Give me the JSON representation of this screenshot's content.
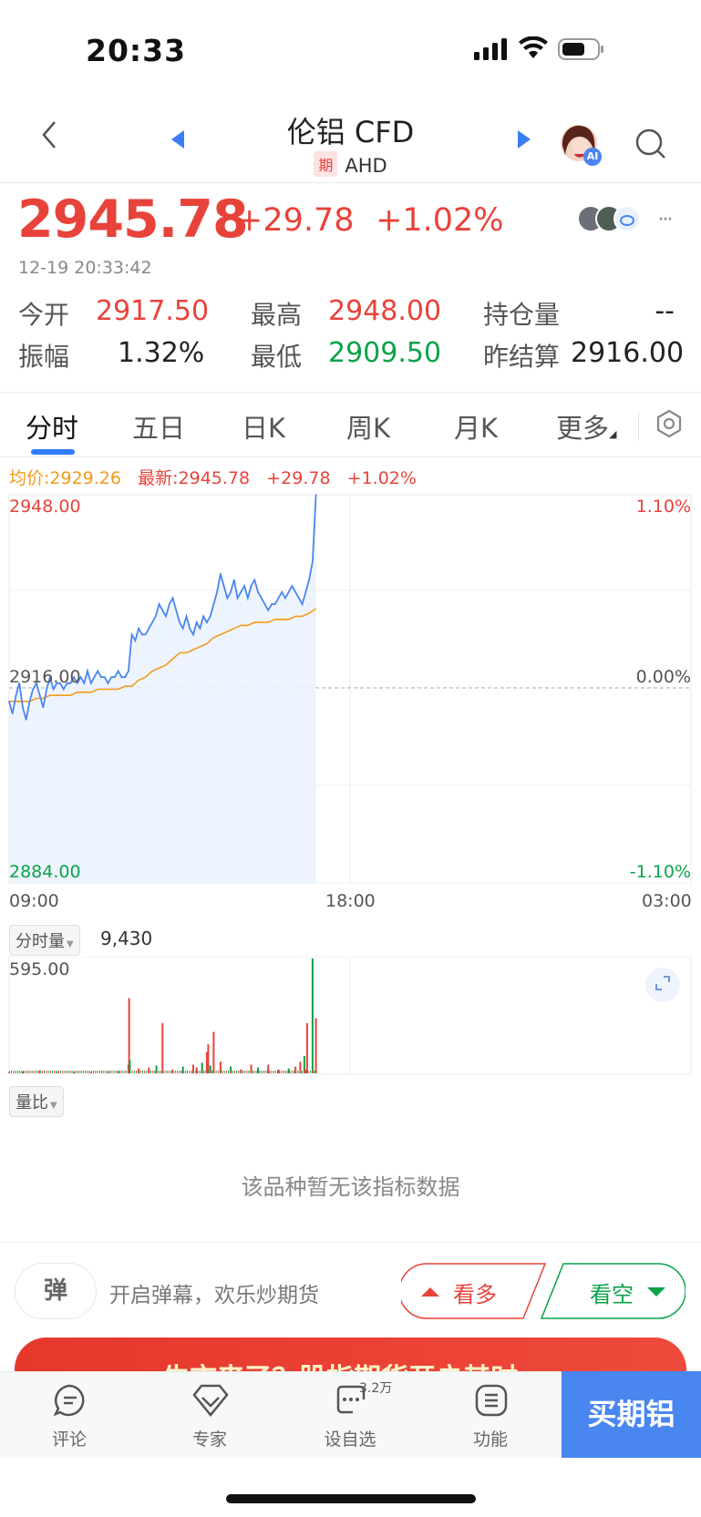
{
  "status": {
    "time": "20:33"
  },
  "nav": {
    "title": "伦铝 CFD",
    "badge": "期",
    "code": "AHD",
    "avatar_badge": "AI"
  },
  "quote": {
    "price": "2945.78",
    "change": "+29.78",
    "change_pct": "+1.02%",
    "time": "12-19 20:33:42",
    "more": "···"
  },
  "stats": {
    "open_label": "今开",
    "open": "2917.50",
    "high_label": "最高",
    "high": "2948.00",
    "oi_label": "持仓量",
    "oi": "--",
    "amp_label": "振幅",
    "amp": "1.32%",
    "low_label": "最低",
    "low": "2909.50",
    "settle_label": "昨结算",
    "settle": "2916.00"
  },
  "tabs": [
    "分时",
    "五日",
    "日K",
    "周K",
    "月K",
    "更多"
  ],
  "info": {
    "avg": "均价:2929.26",
    "latest": "最新:2945.78",
    "chg": "+29.78",
    "pct": "+1.02%"
  },
  "price_chart": {
    "y_top": "2948.00",
    "y_mid": "2916.00",
    "y_bottom": "2884.00",
    "pct_top": "1.10%",
    "pct_mid": "0.00%",
    "pct_bottom": "-1.10%",
    "x_labels": [
      "09:00",
      "18:00",
      "03:00"
    ]
  },
  "volume": {
    "selector": "分时量",
    "value": "9,430",
    "max_label": "595.00"
  },
  "ratio": {
    "selector": "量比",
    "empty": "该品种暂无该指标数据"
  },
  "actions": {
    "danmu_icon": "弹",
    "danmu_text": "开启弹幕，欢乐炒期货",
    "bull": "看多",
    "bear": "看空"
  },
  "banner": {
    "text": "牛市来了？股指期货开户其时 ›"
  },
  "tabbar": {
    "comment": "评论",
    "expert": "专家",
    "watch": "设自选",
    "watch_count": "3.2万",
    "function": "功能",
    "buy": "买期铝"
  },
  "colors": {
    "up": "#e8433b",
    "down": "#0aa34a",
    "accent": "#2f7cf6",
    "avg_line": "#f39a1b",
    "price_line": "#4a86f0"
  },
  "chart_data": {
    "type": "line",
    "title": "",
    "ylim": [
      2884,
      2948
    ],
    "reference": 2916,
    "series": [
      {
        "name": "",
        "x": [
          0,
          5,
          10,
          15,
          20,
          25,
          30,
          35,
          40,
          45,
          50,
          55,
          60,
          65,
          70,
          75,
          80,
          85,
          90,
          95,
          100,
          105,
          110,
          115,
          120,
          125,
          130,
          135,
          140,
          145,
          150,
          155,
          160,
          165,
          170,
          175,
          180,
          185,
          190,
          195,
          200,
          205,
          210,
          215,
          220,
          225,
          230,
          235,
          240,
          245,
          250,
          255,
          260,
          265,
          270,
          275,
          280,
          285,
          290,
          295,
          300,
          305,
          310,
          315,
          320,
          325,
          330,
          335,
          340,
          345,
          350,
          355,
          360,
          365,
          370,
          375,
          380,
          385,
          390,
          395,
          400,
          405,
          410,
          415,
          420,
          425,
          430,
          435,
          440,
          445,
          450
        ],
        "values": [
          2914,
          2912,
          2915,
          2917,
          2913,
          2911,
          2914,
          2916,
          2917,
          2915,
          2913,
          2916,
          2918,
          2916,
          2917,
          2917,
          2916,
          2917,
          2917,
          2918,
          2917,
          2918,
          2917,
          2919,
          2917,
          2918,
          2919,
          2918,
          2918,
          2917,
          2918,
          2918,
          2919,
          2918,
          2918,
          2919,
          2925,
          2924,
          2926,
          2925,
          2925,
          2926,
          2927,
          2928,
          2930,
          2929,
          2928,
          2930,
          2931,
          2929,
          2927,
          2926,
          2928,
          2926,
          2925,
          2927,
          2926,
          2928,
          2927,
          2928,
          2930,
          2932,
          2935,
          2933,
          2931,
          2932,
          2934,
          2931,
          2932,
          2933,
          2931,
          2933,
          2934,
          2932,
          2931,
          2930,
          2929,
          2930,
          2930,
          2931,
          2932,
          2931,
          2932,
          2933,
          2932,
          2931,
          2930,
          2932,
          2934,
          2937,
          2948
        ]
      },
      {
        "name": "",
        "x": [
          0,
          10,
          20,
          30,
          40,
          50,
          60,
          70,
          80,
          90,
          100,
          110,
          120,
          130,
          140,
          150,
          160,
          170,
          180,
          190,
          200,
          210,
          220,
          230,
          240,
          250,
          260,
          270,
          280,
          290,
          300,
          310,
          320,
          330,
          340,
          350,
          360,
          370,
          380,
          390,
          400,
          410,
          420,
          430,
          440,
          450
        ],
        "values": [
          2914,
          2914,
          2914,
          2914,
          2914.5,
          2914.5,
          2915,
          2915,
          2915,
          2915,
          2915.5,
          2915.5,
          2915.5,
          2916,
          2916,
          2916,
          2916,
          2916.5,
          2916.5,
          2917.5,
          2918,
          2919,
          2919.5,
          2920,
          2921,
          2922,
          2922,
          2922.5,
          2923,
          2923.5,
          2924.5,
          2925,
          2925.5,
          2926,
          2926.5,
          2926.5,
          2927,
          2927,
          2927,
          2927.5,
          2927.5,
          2927.5,
          2928,
          2928,
          2928.5,
          2929.26
        ]
      }
    ],
    "volume": {
      "ylim": [
        0,
        595
      ],
      "x": [
        0,
        20,
        45,
        70,
        95,
        120,
        145,
        160,
        175,
        176,
        177,
        190,
        205,
        216,
        225,
        240,
        255,
        270,
        275,
        283,
        290,
        292,
        295,
        300,
        310,
        325,
        340,
        355,
        365,
        380,
        395,
        410,
        420,
        427,
        433,
        434,
        437,
        445,
        450
      ],
      "values": [
        5,
        10,
        15,
        8,
        6,
        5,
        8,
        12,
        45,
        390,
        70,
        25,
        30,
        40,
        260,
        20,
        35,
        45,
        30,
        55,
        110,
        150,
        40,
        215,
        60,
        35,
        20,
        45,
        30,
        45,
        20,
        25,
        35,
        60,
        90,
        20,
        260,
        595,
        285
      ]
    }
  }
}
